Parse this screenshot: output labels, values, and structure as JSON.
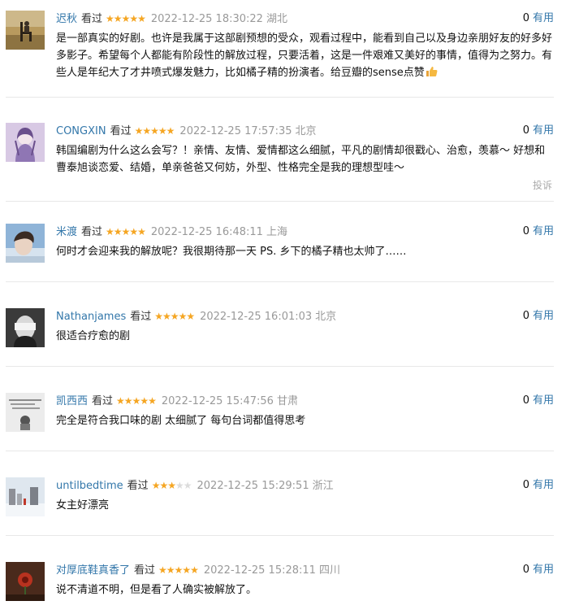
{
  "colors": {
    "accent": "#3377aa",
    "star_on": "#f5a623",
    "star_off": "#dcdcdc",
    "meta": "#999999",
    "separator": "#e8e8e8"
  },
  "comments": [
    {
      "user": "迟秋",
      "status": "看过",
      "rating": 5,
      "time": "2022-12-25 18:30:22",
      "location": "湖北",
      "votes": "0",
      "vote_label": "有用",
      "text": "是一部真实的好剧。也许是我属于这部剧预想的受众，观看过程中，能看到自己以及身边亲朋好友的好多好多影子。希望每个人都能有阶段性的解放过程，只要活着，这是一件艰难又美好的事情，值得为之努力。有些人是年纪大了才井喷式爆发魅力，比如橘子精的扮演者。给豆瓣的sense点赞",
      "emoji_icon": "thumbs-up-icon",
      "avatar_icon": "chair-field-avatar"
    },
    {
      "user": "CONGXIN",
      "status": "看过",
      "rating": 5,
      "time": "2022-12-25 17:57:35",
      "location": "北京",
      "votes": "0",
      "vote_label": "有用",
      "text": "韩国编剧为什么这么会写？！亲情、友情、爱情都这么细腻，平凡的剧情却很戳心、治愈，羡慕～ 好想和曹泰旭谈恋爱、结婚，单亲爸爸又何妨，外型、性格完全是我的理想型哇～",
      "report": "投诉",
      "avatar_icon": "anime-girl-avatar"
    },
    {
      "user": "米渡",
      "status": "看过",
      "rating": 5,
      "time": "2022-12-25 16:48:11",
      "location": "上海",
      "votes": "0",
      "vote_label": "有用",
      "text": "何时才会迎来我的解放呢？我很期待那一天 PS. 乡下的橘子精也太帅了……",
      "avatar_icon": "portrait-sky-avatar"
    },
    {
      "user": "Nathanjames",
      "status": "看过",
      "rating": 5,
      "time": "2022-12-25 16:01:03",
      "location": "北京",
      "votes": "0",
      "vote_label": "有用",
      "text": "很适合疗愈的剧",
      "avatar_icon": "blindfold-portrait-avatar"
    },
    {
      "user": "凯西西",
      "status": "看过",
      "rating": 5,
      "time": "2022-12-25 15:47:56",
      "location": "甘肃",
      "votes": "0",
      "vote_label": "有用",
      "text": "完全是符合我口味的剧 太细腻了 每句台词都值得思考",
      "avatar_icon": "sketch-text-avatar"
    },
    {
      "user": "untilbedtime",
      "status": "看过",
      "rating": 3,
      "time": "2022-12-25 15:29:51",
      "location": "浙江",
      "votes": "0",
      "vote_label": "有用",
      "text": "女主好漂亮",
      "avatar_icon": "winter-street-avatar"
    },
    {
      "user": "对厚底鞋真香了",
      "status": "看过",
      "rating": 5,
      "time": "2022-12-25 15:28:11",
      "location": "四川",
      "votes": "0",
      "vote_label": "有用",
      "text": "说不清道不明，但是看了人确实被解放了。",
      "avatar_icon": "red-flower-avatar"
    }
  ]
}
